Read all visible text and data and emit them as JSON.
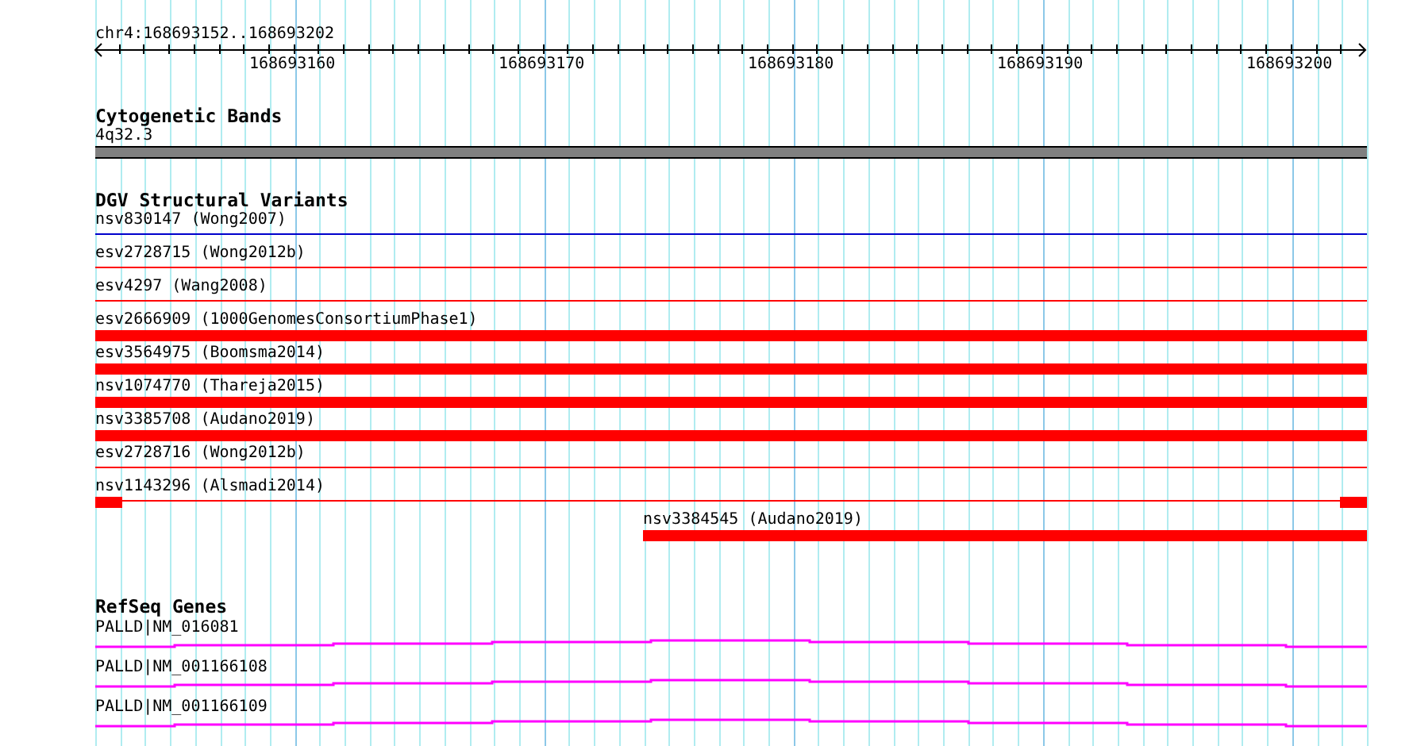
{
  "ruler": {
    "location": "chr4:168693152..168693202",
    "ticks": [
      "168693160",
      "168693170",
      "168693180",
      "168693190",
      "168693200"
    ]
  },
  "cytogenetic_bands": {
    "title": "Cytogenetic Bands",
    "band": "4q32.3"
  },
  "dgv": {
    "title": "DGV Structural Variants",
    "features": [
      {
        "label": "nsv830147 (Wong2007)",
        "kind": "line",
        "color": "#0000cc"
      },
      {
        "label": "esv2728715 (Wong2012b)",
        "kind": "line",
        "color": "#ff0000"
      },
      {
        "label": "esv4297 (Wang2008)",
        "kind": "line",
        "color": "#ff0000"
      },
      {
        "label": "esv2666909 (1000GenomesConsortiumPhase1)",
        "kind": "bar",
        "color": "#ff0000"
      },
      {
        "label": "esv3564975 (Boomsma2014)",
        "kind": "bar",
        "color": "#ff0000"
      },
      {
        "label": "nsv1074770 (Thareja2015)",
        "kind": "bar",
        "color": "#ff0000"
      },
      {
        "label": "nsv3385708 (Audano2019)",
        "kind": "bar",
        "color": "#ff0000"
      },
      {
        "label": "esv2728716 (Wong2012b)",
        "kind": "line",
        "color": "#ff0000"
      },
      {
        "label": "nsv1143296 (Alsmadi2014)",
        "kind": "ends",
        "color": "#ff0000"
      },
      {
        "label": "nsv3384545 (Audano2019)",
        "kind": "right_bar",
        "color": "#ff0000"
      }
    ]
  },
  "refseq": {
    "title": "RefSeq Genes",
    "genes": [
      {
        "label": "PALLD|NM_016081"
      },
      {
        "label": "PALLD|NM_001166108"
      },
      {
        "label": "PALLD|NM_001166109"
      }
    ]
  }
}
